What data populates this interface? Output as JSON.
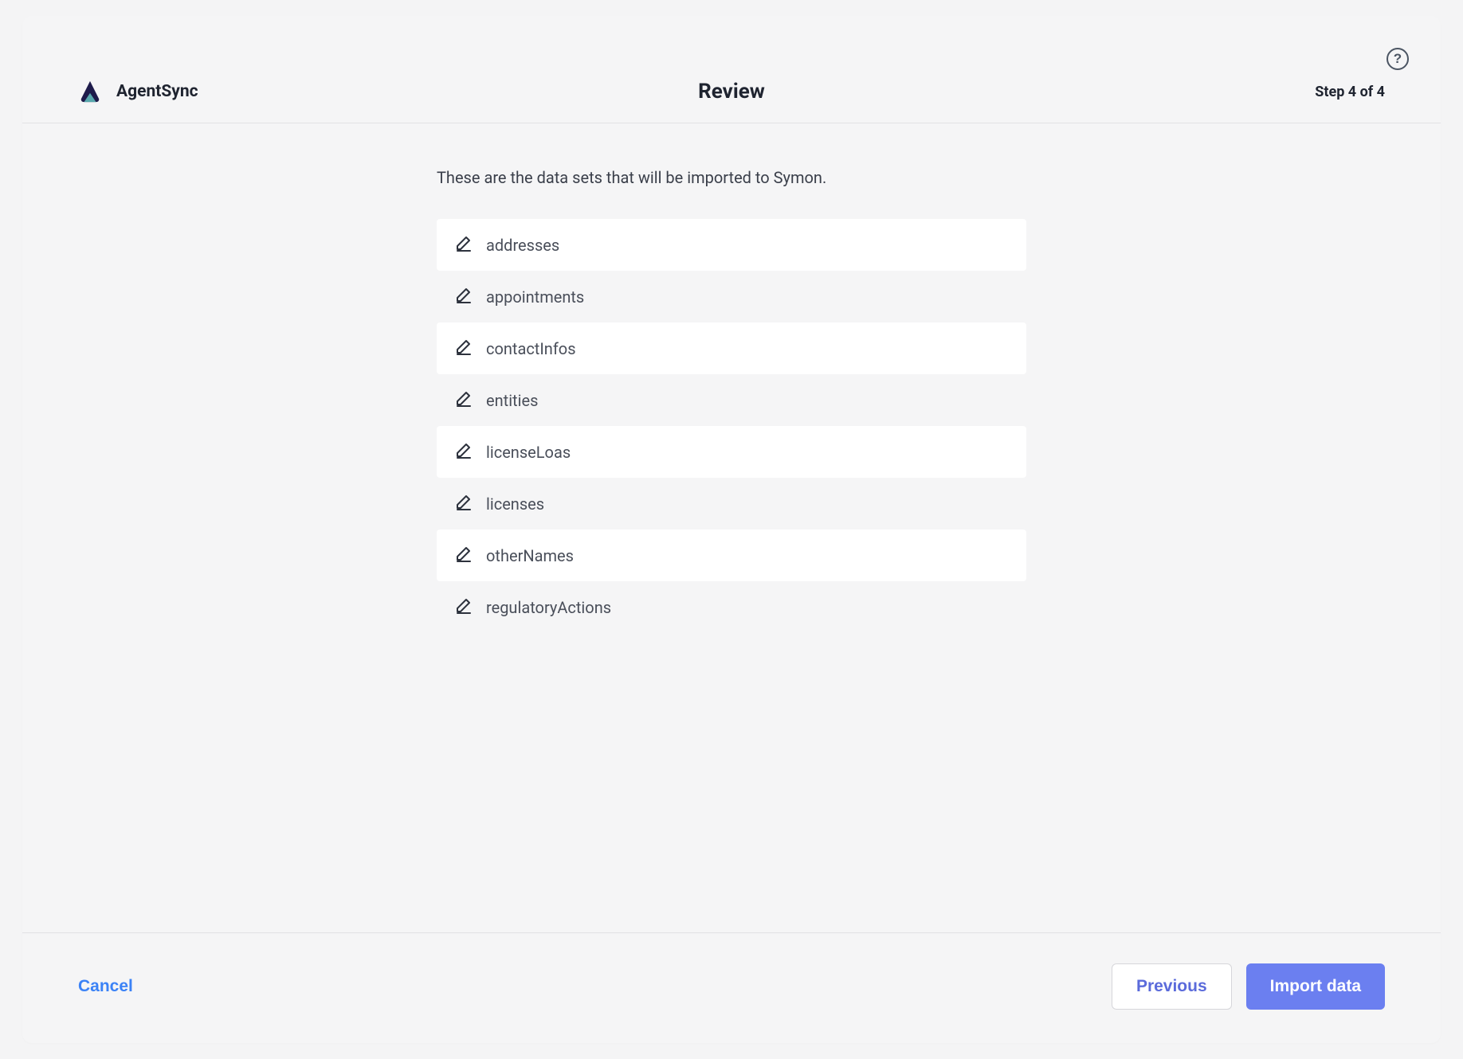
{
  "header": {
    "app_name": "AgentSync",
    "title": "Review",
    "step_label": "Step 4 of 4"
  },
  "help": {
    "label": "?"
  },
  "content": {
    "description": "These are the data sets that will be imported to Symon.",
    "datasets": [
      {
        "name": "addresses"
      },
      {
        "name": "appointments"
      },
      {
        "name": "contactInfos"
      },
      {
        "name": "entities"
      },
      {
        "name": "licenseLoas"
      },
      {
        "name": "licenses"
      },
      {
        "name": "otherNames"
      },
      {
        "name": "regulatoryActions"
      }
    ]
  },
  "footer": {
    "cancel_label": "Cancel",
    "previous_label": "Previous",
    "import_label": "Import data"
  },
  "colors": {
    "primary_button": "#6b7ff0",
    "link": "#3b82f6",
    "logo_dark": "#1e1b4b",
    "logo_teal": "#5fb8b8"
  }
}
